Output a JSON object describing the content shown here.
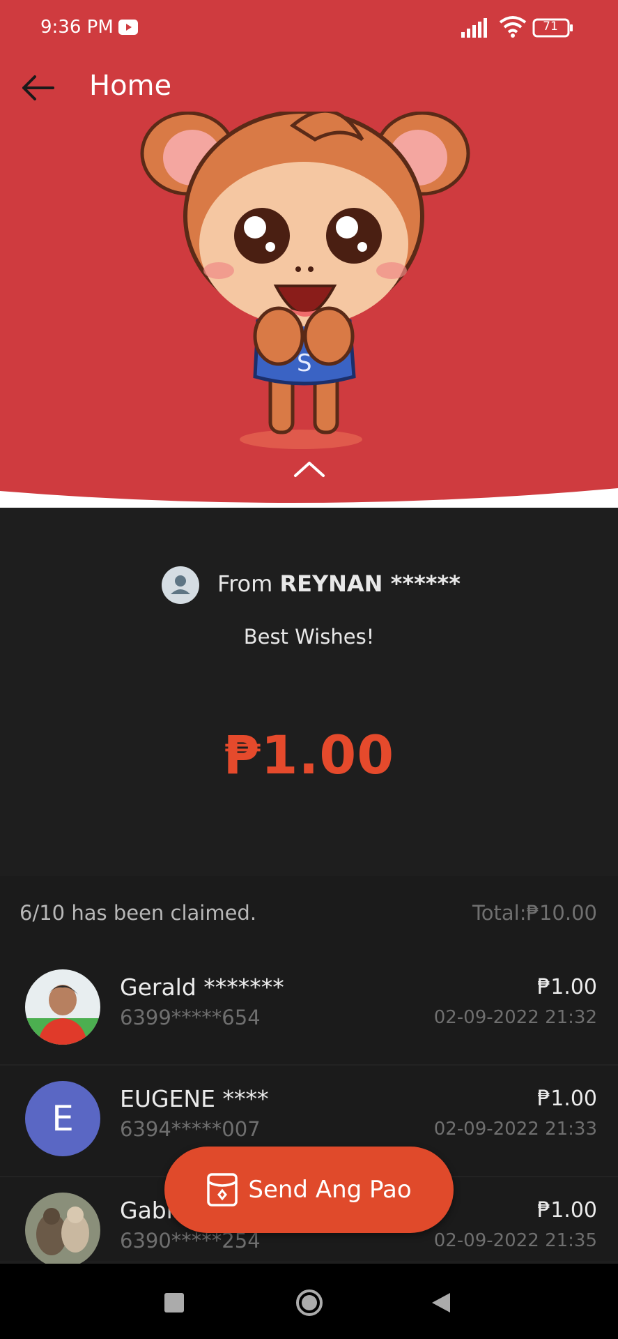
{
  "status_bar": {
    "time": "9:36 PM",
    "battery": "71"
  },
  "header": {
    "title": "Home",
    "back_icon": "arrow-left-icon",
    "collapse_icon": "chevron-up-icon"
  },
  "envelope": {
    "from_prefix": "From ",
    "sender_name": "REYNAN ******",
    "greeting": "Best Wishes!",
    "amount": "₱1.00"
  },
  "claims": {
    "summary": "6/10 has been claimed.",
    "total": "Total:₱10.00",
    "rows": [
      {
        "name": "Gerald *******",
        "phone": "6399*****654",
        "amount": "₱1.00",
        "date": "02-09-2022 21:32"
      },
      {
        "name": "EUGENE ****",
        "initial": "E",
        "phone": "6394*****007",
        "amount": "₱1.00",
        "date": "02-09-2022 21:33"
      },
      {
        "name": "Gabri",
        "phone": "6390*****254",
        "amount": "₱1.00",
        "date": "02-09-2022 21:35"
      }
    ]
  },
  "actions": {
    "send_label": "Send Ang Pao"
  },
  "colors": {
    "header_red": "#cf3b3f",
    "accent_orange": "#e04a2b",
    "amount_red": "#e54a2c",
    "background": "#1e1e1e",
    "letter_avatar": "#5a67c4"
  }
}
